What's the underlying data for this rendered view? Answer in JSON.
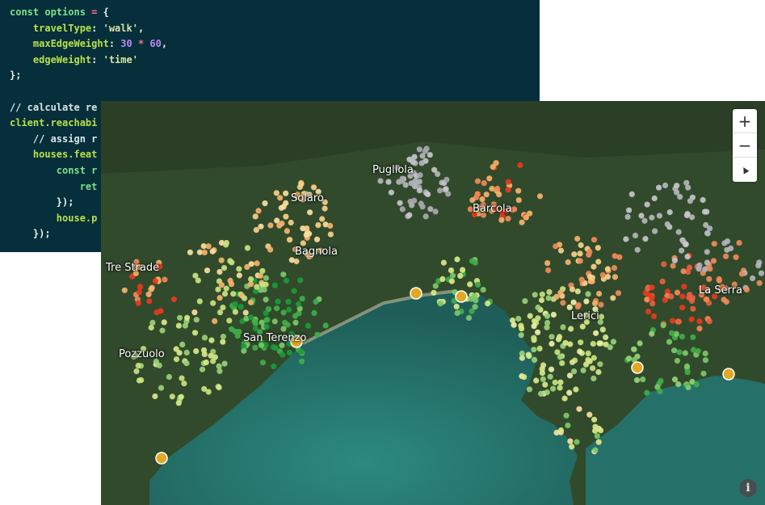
{
  "code": {
    "lines": [
      [
        {
          "t": "const options ",
          "c": "kw"
        },
        {
          "t": "= ",
          "c": "op"
        },
        {
          "t": "{",
          "c": "plain"
        }
      ],
      [
        {
          "t": "    travelType",
          "c": "prop"
        },
        {
          "t": ": ",
          "c": "plain"
        },
        {
          "t": "'walk'",
          "c": "str"
        },
        {
          "t": ",",
          "c": "plain"
        }
      ],
      [
        {
          "t": "    maxEdgeWeight",
          "c": "prop"
        },
        {
          "t": ": ",
          "c": "plain"
        },
        {
          "t": "30",
          "c": "num"
        },
        {
          "t": " * ",
          "c": "op"
        },
        {
          "t": "60",
          "c": "num"
        },
        {
          "t": ",",
          "c": "plain"
        }
      ],
      [
        {
          "t": "    edgeWeight",
          "c": "prop"
        },
        {
          "t": ": ",
          "c": "plain"
        },
        {
          "t": "'time'",
          "c": "str"
        }
      ],
      [
        {
          "t": "};",
          "c": "plain"
        }
      ],
      [
        {
          "t": "",
          "c": "plain"
        }
      ],
      [
        {
          "t": "// calculate re",
          "c": "cm"
        }
      ],
      [
        {
          "t": "client.reachabi",
          "c": "prop"
        }
      ],
      [
        {
          "t": "    // assign r",
          "c": "cm"
        }
      ],
      [
        {
          "t": "    houses.feat",
          "c": "prop"
        }
      ],
      [
        {
          "t": "        const r",
          "c": "kw"
        }
      ],
      [
        {
          "t": "            ret",
          "c": "kw"
        }
      ],
      [
        {
          "t": "        });",
          "c": "plain"
        }
      ],
      [
        {
          "t": "        house.p",
          "c": "prop"
        }
      ],
      [
        {
          "t": "    });",
          "c": "plain"
        }
      ]
    ]
  },
  "map": {
    "places": [
      {
        "name": "Pugliola"
      },
      {
        "name": "Solaro"
      },
      {
        "name": "Barcola"
      },
      {
        "name": "Bagnola"
      },
      {
        "name": "Tre Strade"
      },
      {
        "name": "La Serra"
      },
      {
        "name": "Lerici"
      },
      {
        "name": "San Terenzo"
      },
      {
        "name": "Pozzuolo"
      }
    ],
    "controls": {
      "zoom_in": "+",
      "zoom_out": "−",
      "compass": "▲",
      "info": "i"
    },
    "colors": {
      "near": "#1a9a3a",
      "mid": "#d8e88a",
      "far": "#e83a1e",
      "unreachable": "#b4b4bc",
      "sea": "#2a7a72",
      "stop": "#e0a823"
    }
  }
}
